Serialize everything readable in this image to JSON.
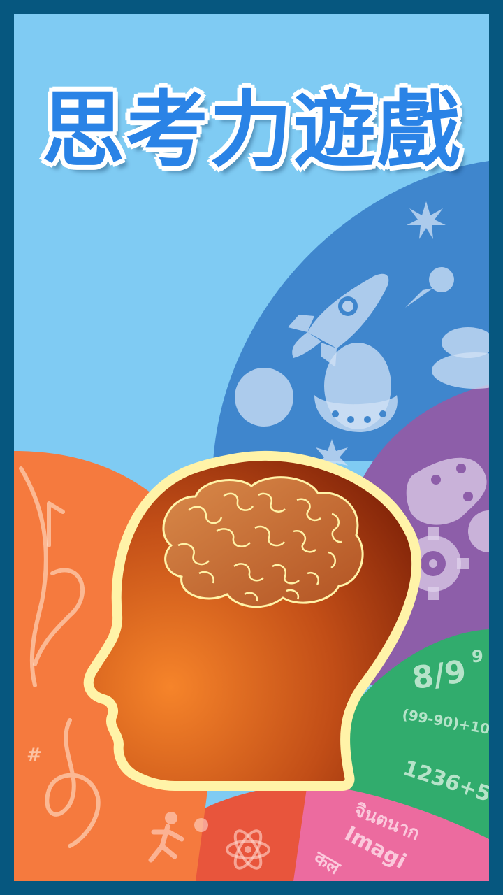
{
  "title": "思考力遊戲",
  "decor": {
    "math_fraction": "8/9",
    "math_exponent": "9",
    "math_expr1": "(99-90)+10",
    "math_expr2": "1236+5",
    "lang_thai": "จินตนาก",
    "lang_english": "Imagi",
    "lang_hindi": "कल",
    "music_sharp": "#"
  },
  "colors": {
    "sky": "#7fcbf3",
    "border": "#06577f",
    "space_blue": "#3f86cd",
    "purple": "#8d5ea9",
    "green": "#31ac6d",
    "pink": "#ec6b9f",
    "orange": "#f57a3e",
    "red": "#e8553c",
    "head_stroke": "#fff3a8",
    "title_blue": "#2a83e6"
  }
}
